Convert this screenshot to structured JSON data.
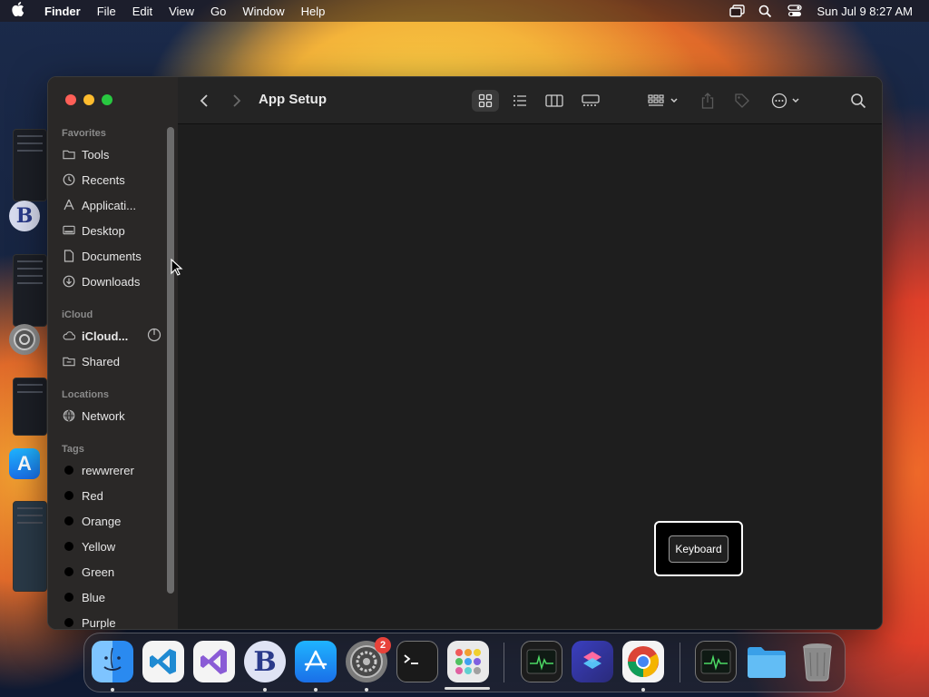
{
  "menubar": {
    "app_name": "Finder",
    "items": [
      "File",
      "Edit",
      "View",
      "Go",
      "Window",
      "Help"
    ],
    "clock": "Sun Jul 9  8:27 AM"
  },
  "window": {
    "title": "App Setup"
  },
  "sidebar": {
    "favorites_title": "Favorites",
    "favorites": [
      {
        "label": "Tools",
        "icon": "folder-icon"
      },
      {
        "label": "Recents",
        "icon": "clock-icon"
      },
      {
        "label": "Applicati...",
        "icon": "applications-icon"
      },
      {
        "label": "Desktop",
        "icon": "desktop-icon"
      },
      {
        "label": "Documents",
        "icon": "document-icon"
      },
      {
        "label": "Downloads",
        "icon": "download-icon"
      }
    ],
    "icloud_title": "iCloud",
    "icloud": [
      {
        "label": "iCloud...",
        "icon": "cloud-icon"
      },
      {
        "label": "Shared",
        "icon": "shared-folder-icon"
      }
    ],
    "locations_title": "Locations",
    "locations": [
      {
        "label": "Network",
        "icon": "globe-icon"
      }
    ],
    "tags_title": "Tags",
    "tags": [
      {
        "label": "rewwrerer"
      },
      {
        "label": "Red"
      },
      {
        "label": "Orange"
      },
      {
        "label": "Yellow"
      },
      {
        "label": "Green"
      },
      {
        "label": "Blue"
      },
      {
        "label": "Purple"
      }
    ]
  },
  "keyboard_popup": {
    "button_label": "Keyboard"
  },
  "dock": {
    "badge_count": "2"
  },
  "colors": {
    "close": "#ff5f57",
    "minimize": "#febc2e",
    "zoom": "#28c840"
  }
}
